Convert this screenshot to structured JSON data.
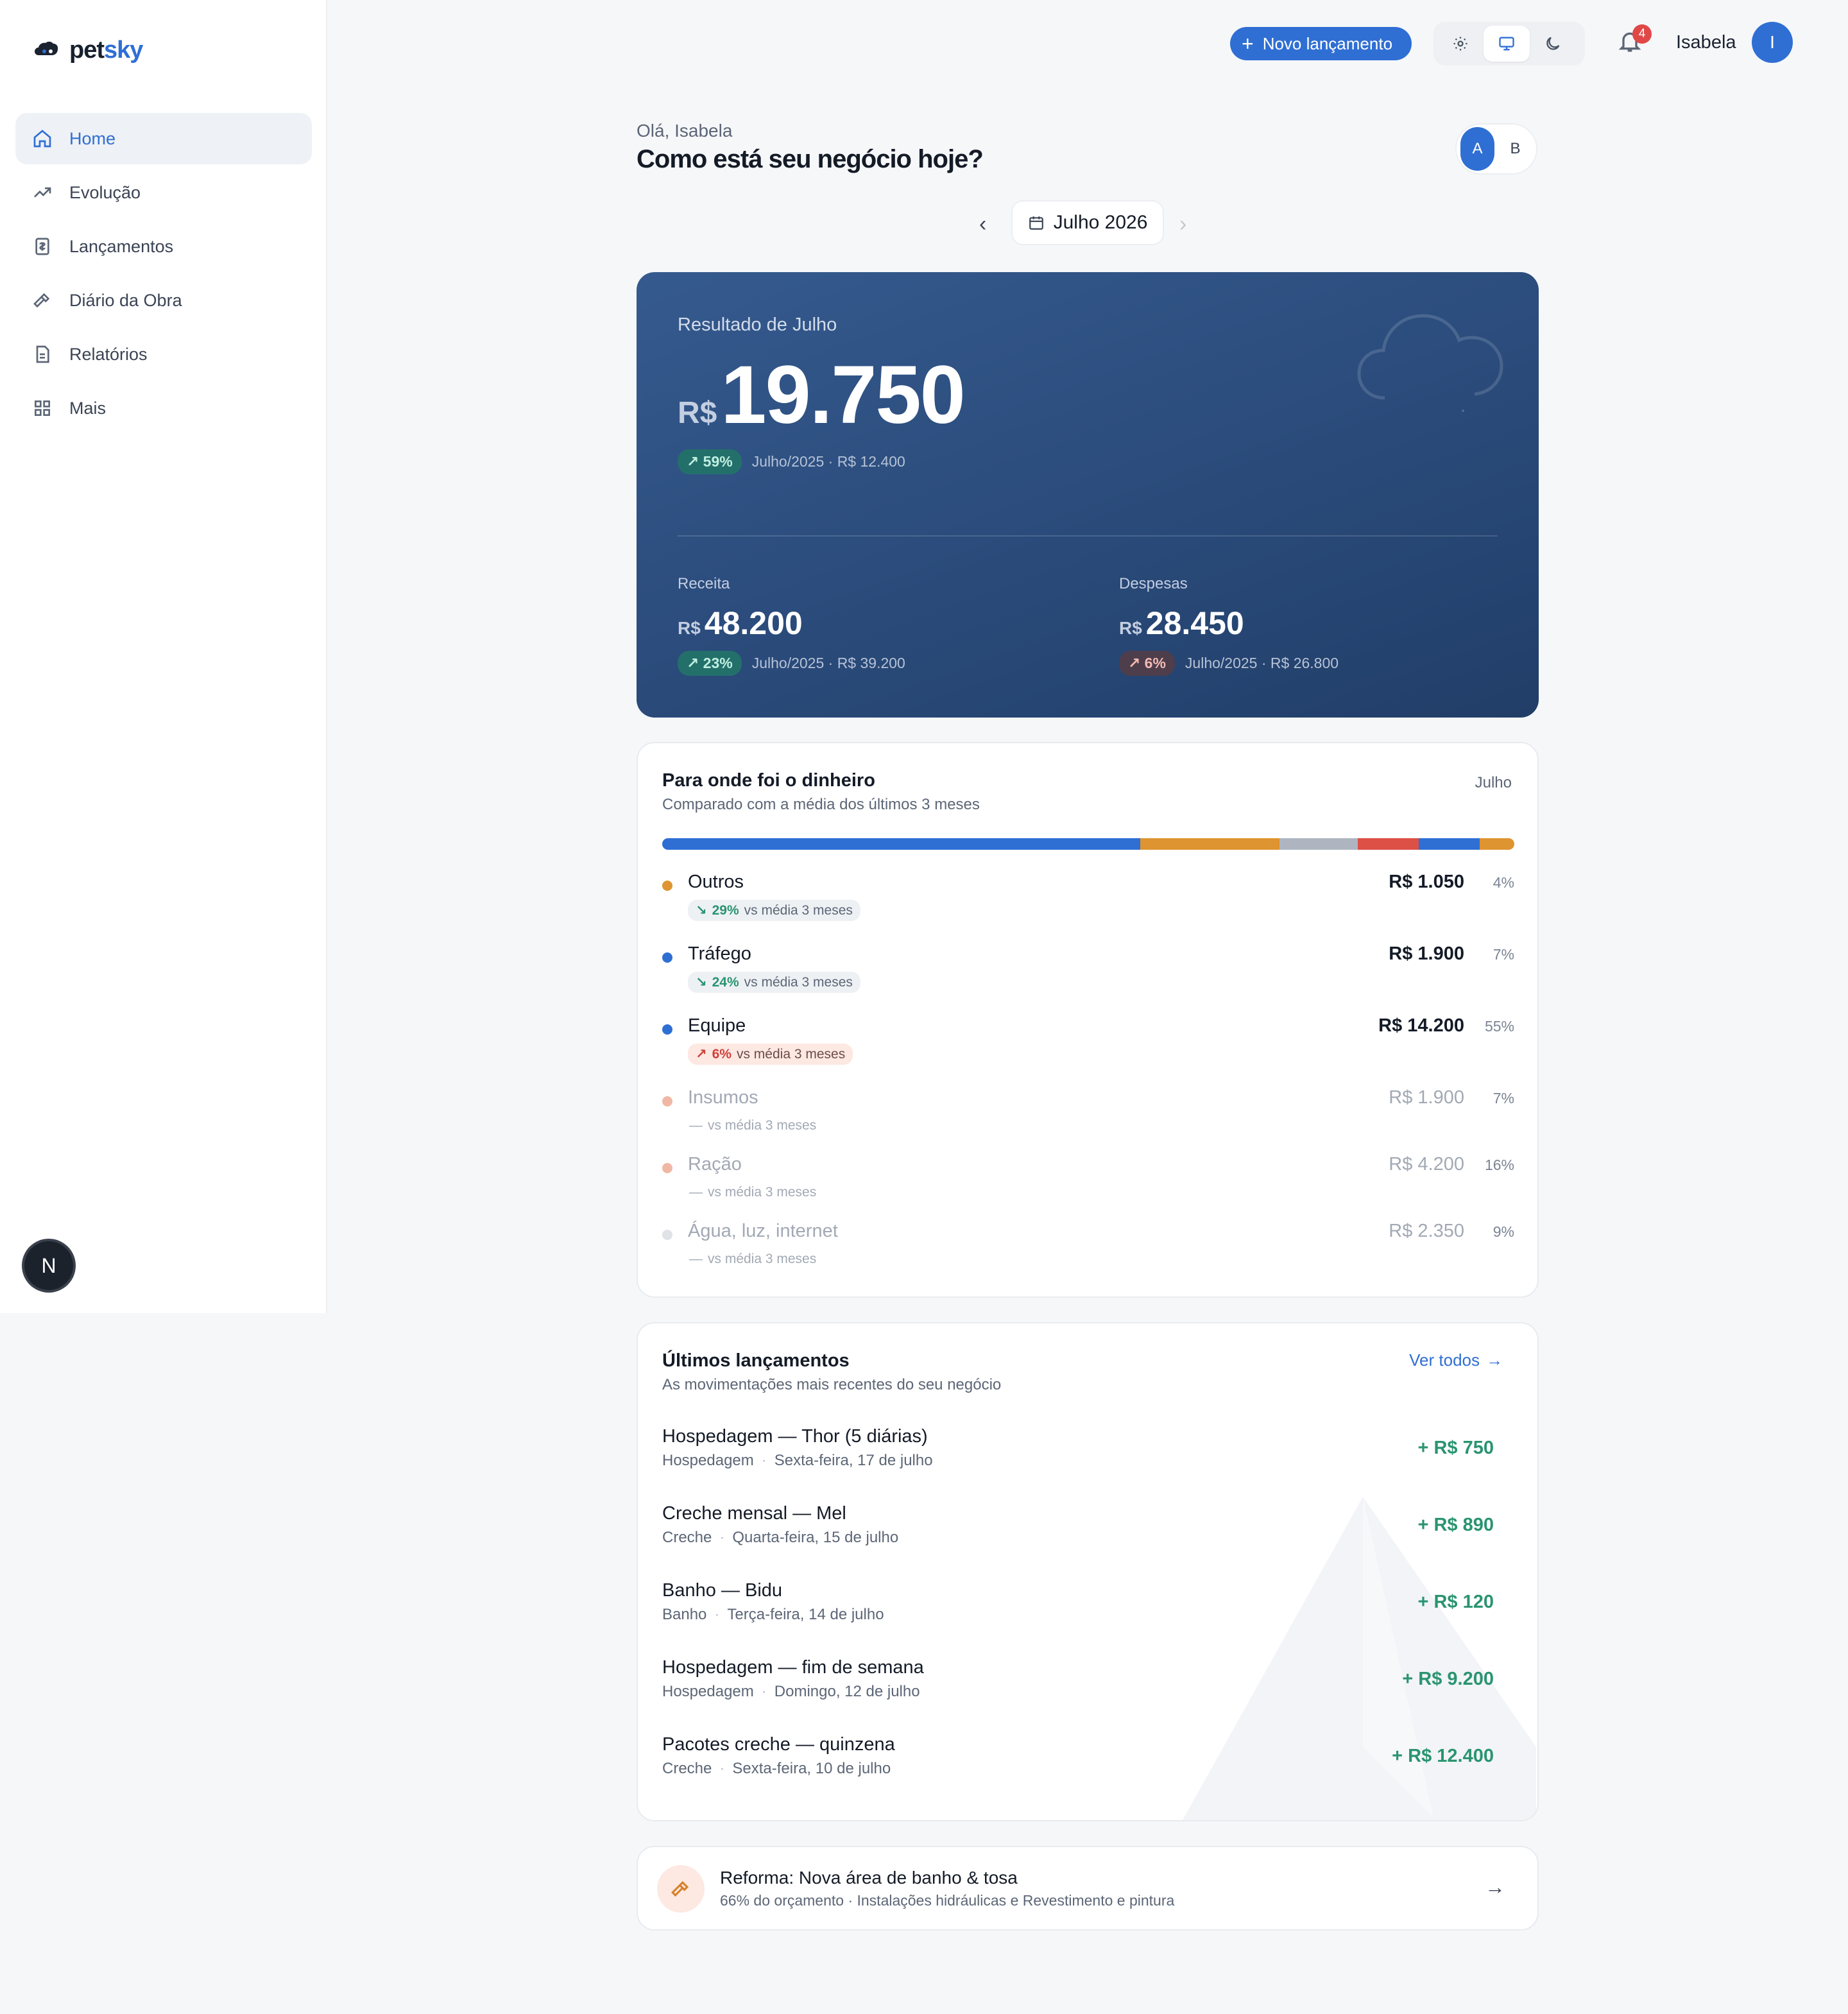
{
  "brand": {
    "part1": "pet",
    "part2": "sky"
  },
  "sidebar": {
    "items": [
      {
        "label": "Home",
        "icon": "home-icon",
        "active": true
      },
      {
        "label": "Evolução",
        "icon": "trend-icon"
      },
      {
        "label": "Lançamentos",
        "icon": "receipt-icon"
      },
      {
        "label": "Diário da Obra",
        "icon": "hammer-icon"
      },
      {
        "label": "Relatórios",
        "icon": "file-icon"
      },
      {
        "label": "Mais",
        "icon": "grid-icon"
      }
    ],
    "badge": "N"
  },
  "topbar": {
    "new_button": "Novo lançamento",
    "notifications_count": "4",
    "user_name": "Isabela",
    "avatar_initial": "I"
  },
  "header": {
    "greeting": "Olá, Isabela",
    "headline": "Como está seu negócio hoje?",
    "toggle": [
      "A",
      "B"
    ],
    "month": "Julho 2026"
  },
  "result": {
    "title": "Resultado de Julho",
    "currency": "R$",
    "value": "19.750",
    "delta": "59%",
    "compare": "Julho/2025 · R$ 12.400",
    "revenue": {
      "label": "Receita",
      "currency": "R$",
      "value": "48.200",
      "delta": "23%",
      "compare": "Julho/2025 · R$ 39.200"
    },
    "expenses": {
      "label": "Despesas",
      "currency": "R$",
      "value": "28.450",
      "delta": "6%",
      "compare": "Julho/2025 · R$ 26.800"
    }
  },
  "money": {
    "title": "Para onde foi o dinheiro",
    "subtitle": "Comparado com a média dos últimos 3 meses",
    "month": "Julho",
    "bar_segments": [
      {
        "share": 55,
        "color": "#2f6fd4"
      },
      {
        "share": 16,
        "color": "#de9430"
      },
      {
        "share": 9,
        "color": "#aeb5c0"
      },
      {
        "share": 7,
        "color": "#dc5045"
      },
      {
        "share": 7,
        "color": "#2f6fd4"
      },
      {
        "share": 4,
        "color": "#de9430"
      }
    ],
    "categories": [
      {
        "name": "Outros",
        "amount": "R$ 1.050",
        "pct": "4%",
        "color": "#de9430",
        "trend": "good",
        "vs_value": "29%",
        "vs_text": "vs média 3 meses"
      },
      {
        "name": "Tráfego",
        "amount": "R$ 1.900",
        "pct": "7%",
        "color": "#2f6fd4",
        "trend": "good",
        "vs_value": "24%",
        "vs_text": "vs média 3 meses"
      },
      {
        "name": "Equipe",
        "amount": "R$ 14.200",
        "pct": "55%",
        "color": "#2f6fd4",
        "trend": "bad",
        "vs_value": "6%",
        "vs_text": "vs média 3 meses"
      },
      {
        "name": "Insumos",
        "amount": "R$ 1.900",
        "pct": "7%",
        "color": "#f0b8a4",
        "trend": "neutral",
        "vs_value": "—",
        "vs_text": "vs média 3 meses"
      },
      {
        "name": "Ração",
        "amount": "R$ 4.200",
        "pct": "16%",
        "color": "#f0b8a4",
        "trend": "neutral",
        "vs_value": "—",
        "vs_text": "vs média 3 meses"
      },
      {
        "name": "Água, luz, internet",
        "amount": "R$ 2.350",
        "pct": "9%",
        "color": "#dfe2e6",
        "trend": "neutral",
        "vs_value": "—",
        "vs_text": "vs média 3 meses"
      }
    ]
  },
  "launches": {
    "title": "Últimos lançamentos",
    "subtitle": "As movimentações mais recentes do seu negócio",
    "see_all": "Ver todos",
    "items": [
      {
        "title": "Hospedagem — Thor (5 diárias)",
        "category": "Hospedagem",
        "date": "Sexta-feira, 17 de julho",
        "amount": "+ R$ 750"
      },
      {
        "title": "Creche mensal — Mel",
        "category": "Creche",
        "date": "Quarta-feira, 15 de julho",
        "amount": "+ R$ 890"
      },
      {
        "title": "Banho — Bidu",
        "category": "Banho",
        "date": "Terça-feira, 14 de julho",
        "amount": "+ R$ 120"
      },
      {
        "title": "Hospedagem — fim de semana",
        "category": "Hospedagem",
        "date": "Domingo, 12 de julho",
        "amount": "+ R$ 9.200"
      },
      {
        "title": "Pacotes creche — quinzena",
        "category": "Creche",
        "date": "Sexta-feira, 10 de julho",
        "amount": "+ R$ 12.400"
      }
    ]
  },
  "project": {
    "title": "Reforma: Nova área de banho & tosa",
    "subtitle": "66% do orçamento · Instalações hidráulicas e Revestimento e pintura"
  }
}
